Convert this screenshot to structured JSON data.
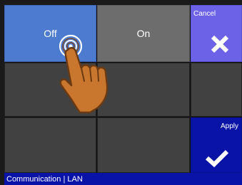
{
  "buttons": {
    "off_label": "Off",
    "on_label": "On",
    "cancel_label": "Cancel",
    "apply_label": "Apply"
  },
  "status_bar": {
    "text": "Communication | LAN"
  },
  "icons": {
    "cancel": "close-icon",
    "apply": "check-icon",
    "touch": "hand-pointer-icon"
  },
  "colors": {
    "off_button": "#4d7bcf",
    "on_button": "#6d6d6d",
    "cancel_button": "#6b62e8",
    "apply_button": "#0a13a8",
    "status_bar": "#0a13a8"
  }
}
